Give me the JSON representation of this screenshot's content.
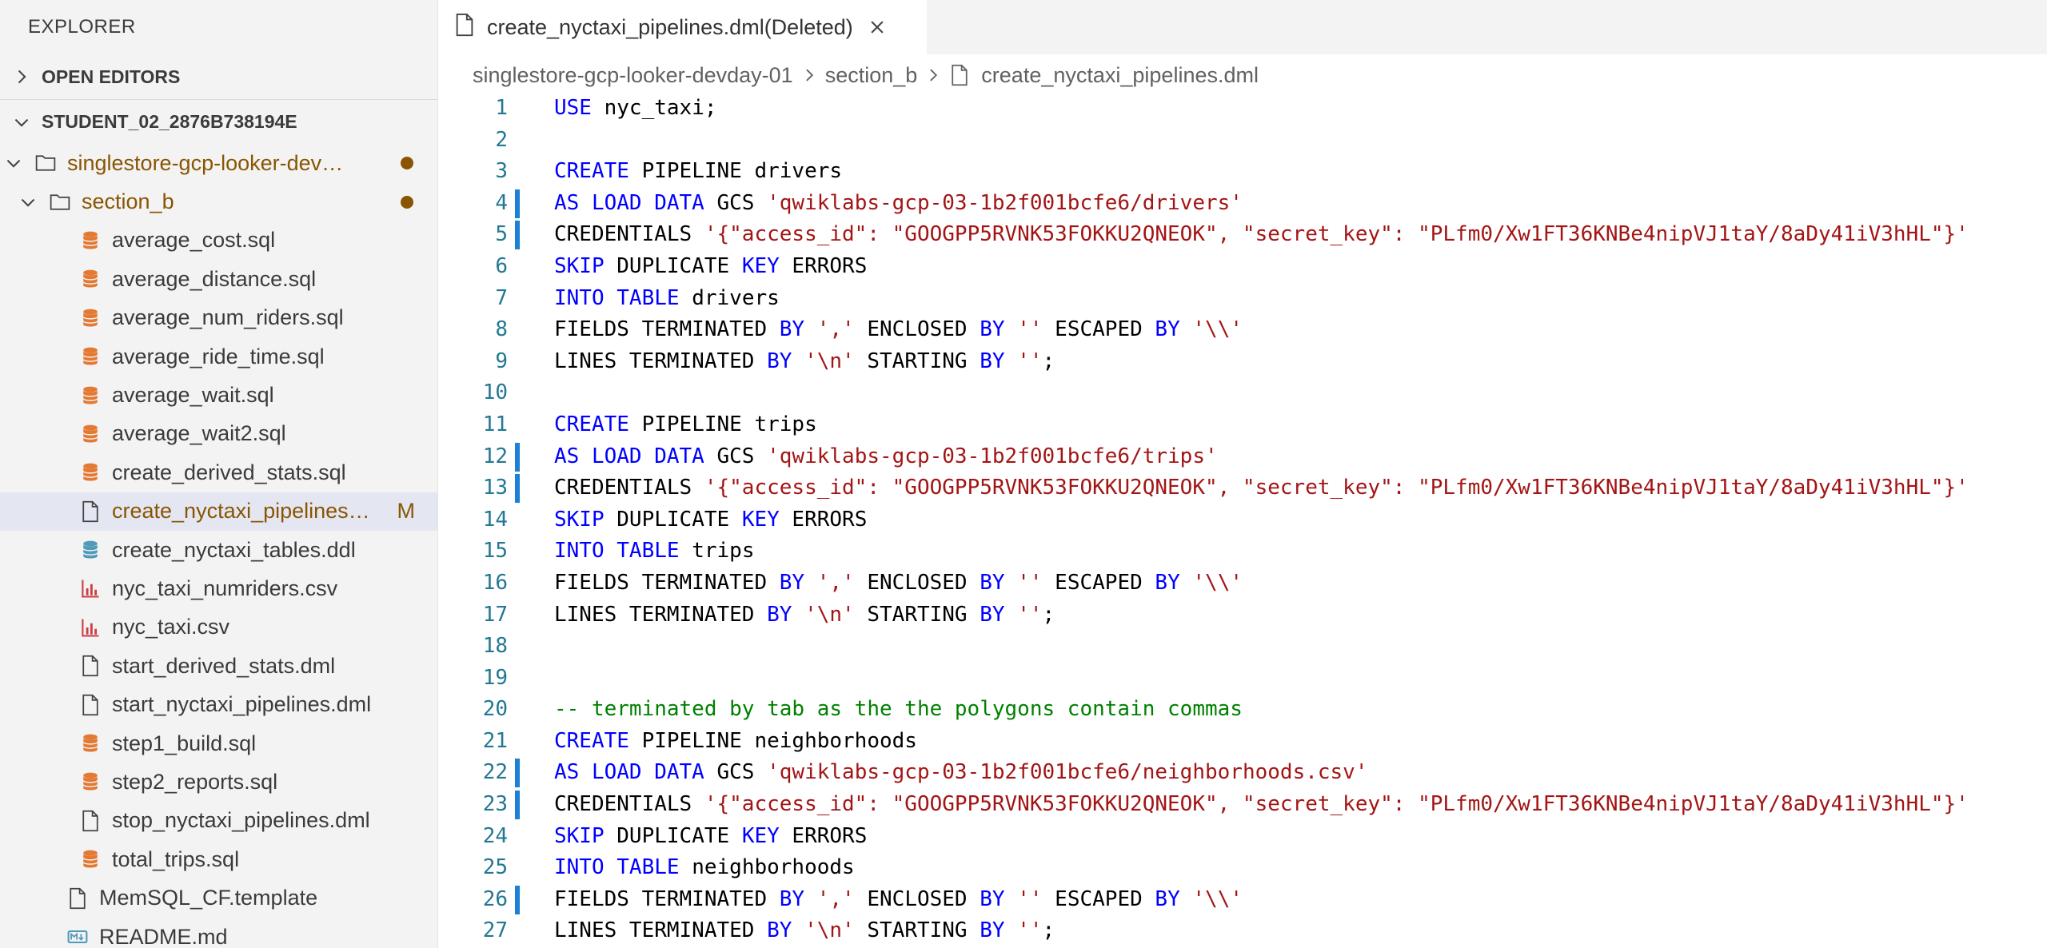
{
  "sidebar": {
    "title": "EXPLORER",
    "open_editors_label": "OPEN EDITORS",
    "workspace_label": "STUDENT_02_2876B738194E",
    "tree": [
      {
        "label": "singlestore-gcp-looker-dev…",
        "type": "folder",
        "level": 1,
        "expanded": true,
        "modified": true
      },
      {
        "label": "section_b",
        "type": "folder",
        "level": 2,
        "expanded": true,
        "modified": true
      },
      {
        "label": "average_cost.sql",
        "type": "sql",
        "level": 3
      },
      {
        "label": "average_distance.sql",
        "type": "sql",
        "level": 3
      },
      {
        "label": "average_num_riders.sql",
        "type": "sql",
        "level": 3
      },
      {
        "label": "average_ride_time.sql",
        "type": "sql",
        "level": 3
      },
      {
        "label": "average_wait.sql",
        "type": "sql",
        "level": 3
      },
      {
        "label": "average_wait2.sql",
        "type": "sql",
        "level": 3
      },
      {
        "label": "create_derived_stats.sql",
        "type": "sql",
        "level": 3
      },
      {
        "label": "create_nyctaxi_pipelines…",
        "type": "file",
        "level": 3,
        "selected": true,
        "modified": true,
        "badge": "M"
      },
      {
        "label": "create_nyctaxi_tables.ddl",
        "type": "db",
        "level": 3
      },
      {
        "label": "nyc_taxi_numriders.csv",
        "type": "csv",
        "level": 3
      },
      {
        "label": "nyc_taxi.csv",
        "type": "csv",
        "level": 3
      },
      {
        "label": "start_derived_stats.dml",
        "type": "file",
        "level": 3
      },
      {
        "label": "start_nyctaxi_pipelines.dml",
        "type": "file",
        "level": 3
      },
      {
        "label": "step1_build.sql",
        "type": "sql",
        "level": 3
      },
      {
        "label": "step2_reports.sql",
        "type": "sql",
        "level": 3
      },
      {
        "label": "stop_nyctaxi_pipelines.dml",
        "type": "file",
        "level": 3
      },
      {
        "label": "total_trips.sql",
        "type": "sql",
        "level": 3
      },
      {
        "label": "MemSQL_CF.template",
        "type": "file",
        "level": 2
      },
      {
        "label": "README.md",
        "type": "md",
        "level": 2
      }
    ]
  },
  "tab": {
    "label": "create_nyctaxi_pipelines.dml(Deleted)",
    "close_icon": "close-icon"
  },
  "breadcrumb": {
    "items": [
      "singlestore-gcp-looker-devday-01",
      "section_b",
      "create_nyctaxi_pipelines.dml"
    ]
  },
  "colors": {
    "keyword": "#0000ff",
    "string": "#a31515",
    "comment": "#008000",
    "line_number": "#237893",
    "gutter_change": "#1b81d6",
    "modified": "#895503"
  },
  "code": {
    "lines": [
      {
        "n": "1",
        "tokens": [
          [
            "kw",
            "USE"
          ],
          [
            "t",
            " nyc_taxi;"
          ]
        ]
      },
      {
        "n": "2",
        "tokens": []
      },
      {
        "n": "3",
        "tokens": [
          [
            "kw",
            "CREATE"
          ],
          [
            "t",
            " PIPELINE drivers"
          ]
        ]
      },
      {
        "n": "4",
        "changed": true,
        "tokens": [
          [
            "kw",
            "AS LOAD DATA"
          ],
          [
            "t",
            " GCS "
          ],
          [
            "str",
            "'qwiklabs-gcp-03-1b2f001bcfe6/drivers'"
          ]
        ]
      },
      {
        "n": "5",
        "changed": true,
        "tokens": [
          [
            "t",
            "CREDENTIALS "
          ],
          [
            "str",
            "'{\"access_id\": \"GOOGPP5RVNK53FOKKU2QNEOK\", \"secret_key\": \"PLfm0/Xw1FT36KNBe4nipVJ1taY/8aDy41iV3hHL\"}'"
          ]
        ]
      },
      {
        "n": "6",
        "tokens": [
          [
            "kw",
            "SKIP"
          ],
          [
            "t",
            " DUPLICATE "
          ],
          [
            "kw",
            "KEY"
          ],
          [
            "t",
            " ERRORS"
          ]
        ]
      },
      {
        "n": "7",
        "tokens": [
          [
            "kw",
            "INTO TABLE"
          ],
          [
            "t",
            " drivers"
          ]
        ]
      },
      {
        "n": "8",
        "tokens": [
          [
            "t",
            "FIELDS TERMINATED "
          ],
          [
            "kw",
            "BY"
          ],
          [
            "t",
            " "
          ],
          [
            "str",
            "','"
          ],
          [
            "t",
            " ENCLOSED "
          ],
          [
            "kw",
            "BY"
          ],
          [
            "t",
            " "
          ],
          [
            "str",
            "''"
          ],
          [
            "t",
            " ESCAPED "
          ],
          [
            "kw",
            "BY"
          ],
          [
            "t",
            " "
          ],
          [
            "str",
            "'\\\\'"
          ]
        ]
      },
      {
        "n": "9",
        "tokens": [
          [
            "t",
            "LINES TERMINATED "
          ],
          [
            "kw",
            "BY"
          ],
          [
            "t",
            " "
          ],
          [
            "str",
            "'\\n'"
          ],
          [
            "t",
            " STARTING "
          ],
          [
            "kw",
            "BY"
          ],
          [
            "t",
            " "
          ],
          [
            "str",
            "''"
          ],
          [
            "t",
            ";"
          ]
        ]
      },
      {
        "n": "10",
        "tokens": []
      },
      {
        "n": "11",
        "tokens": [
          [
            "kw",
            "CREATE"
          ],
          [
            "t",
            " PIPELINE trips"
          ]
        ]
      },
      {
        "n": "12",
        "changed": true,
        "tokens": [
          [
            "kw",
            "AS LOAD DATA"
          ],
          [
            "t",
            " GCS "
          ],
          [
            "str",
            "'qwiklabs-gcp-03-1b2f001bcfe6/trips'"
          ]
        ]
      },
      {
        "n": "13",
        "changed": true,
        "tokens": [
          [
            "t",
            "CREDENTIALS "
          ],
          [
            "str",
            "'{\"access_id\": \"GOOGPP5RVNK53FOKKU2QNEOK\", \"secret_key\": \"PLfm0/Xw1FT36KNBe4nipVJ1taY/8aDy41iV3hHL\"}'"
          ]
        ]
      },
      {
        "n": "14",
        "tokens": [
          [
            "kw",
            "SKIP"
          ],
          [
            "t",
            " DUPLICATE "
          ],
          [
            "kw",
            "KEY"
          ],
          [
            "t",
            " ERRORS"
          ]
        ]
      },
      {
        "n": "15",
        "tokens": [
          [
            "kw",
            "INTO TABLE"
          ],
          [
            "t",
            " trips"
          ]
        ]
      },
      {
        "n": "16",
        "tokens": [
          [
            "t",
            "FIELDS TERMINATED "
          ],
          [
            "kw",
            "BY"
          ],
          [
            "t",
            " "
          ],
          [
            "str",
            "','"
          ],
          [
            "t",
            " ENCLOSED "
          ],
          [
            "kw",
            "BY"
          ],
          [
            "t",
            " "
          ],
          [
            "str",
            "''"
          ],
          [
            "t",
            " ESCAPED "
          ],
          [
            "kw",
            "BY"
          ],
          [
            "t",
            " "
          ],
          [
            "str",
            "'\\\\'"
          ]
        ]
      },
      {
        "n": "17",
        "tokens": [
          [
            "t",
            "LINES TERMINATED "
          ],
          [
            "kw",
            "BY"
          ],
          [
            "t",
            " "
          ],
          [
            "str",
            "'\\n'"
          ],
          [
            "t",
            " STARTING "
          ],
          [
            "kw",
            "BY"
          ],
          [
            "t",
            " "
          ],
          [
            "str",
            "''"
          ],
          [
            "t",
            ";"
          ]
        ]
      },
      {
        "n": "18",
        "tokens": []
      },
      {
        "n": "19",
        "tokens": []
      },
      {
        "n": "20",
        "tokens": [
          [
            "cmt",
            "-- terminated by tab as the the polygons contain commas"
          ]
        ]
      },
      {
        "n": "21",
        "tokens": [
          [
            "kw",
            "CREATE"
          ],
          [
            "t",
            " PIPELINE neighborhoods"
          ]
        ]
      },
      {
        "n": "22",
        "changed": true,
        "tokens": [
          [
            "kw",
            "AS LOAD DATA"
          ],
          [
            "t",
            " GCS "
          ],
          [
            "str",
            "'qwiklabs-gcp-03-1b2f001bcfe6/neighborhoods.csv'"
          ]
        ]
      },
      {
        "n": "23",
        "changed": true,
        "tokens": [
          [
            "t",
            "CREDENTIALS "
          ],
          [
            "str",
            "'{\"access_id\": \"GOOGPP5RVNK53FOKKU2QNEOK\", \"secret_key\": \"PLfm0/Xw1FT36KNBe4nipVJ1taY/8aDy41iV3hHL\"}'"
          ]
        ]
      },
      {
        "n": "24",
        "tokens": [
          [
            "kw",
            "SKIP"
          ],
          [
            "t",
            " DUPLICATE "
          ],
          [
            "kw",
            "KEY"
          ],
          [
            "t",
            " ERRORS"
          ]
        ]
      },
      {
        "n": "25",
        "tokens": [
          [
            "kw",
            "INTO TABLE"
          ],
          [
            "t",
            " neighborhoods"
          ]
        ]
      },
      {
        "n": "26",
        "changed": true,
        "tokens": [
          [
            "t",
            "FIELDS TERMINATED "
          ],
          [
            "kw",
            "BY"
          ],
          [
            "t",
            " "
          ],
          [
            "str",
            "','"
          ],
          [
            "t",
            " ENCLOSED "
          ],
          [
            "kw",
            "BY"
          ],
          [
            "t",
            " "
          ],
          [
            "str",
            "''"
          ],
          [
            "t",
            " ESCAPED "
          ],
          [
            "kw",
            "BY"
          ],
          [
            "t",
            " "
          ],
          [
            "str",
            "'\\\\'"
          ]
        ]
      },
      {
        "n": "27",
        "tokens": [
          [
            "t",
            "LINES TERMINATED "
          ],
          [
            "kw",
            "BY"
          ],
          [
            "t",
            " "
          ],
          [
            "str",
            "'\\n'"
          ],
          [
            "t",
            " STARTING "
          ],
          [
            "kw",
            "BY"
          ],
          [
            "t",
            " "
          ],
          [
            "str",
            "''"
          ],
          [
            "t",
            ";"
          ]
        ]
      }
    ]
  }
}
